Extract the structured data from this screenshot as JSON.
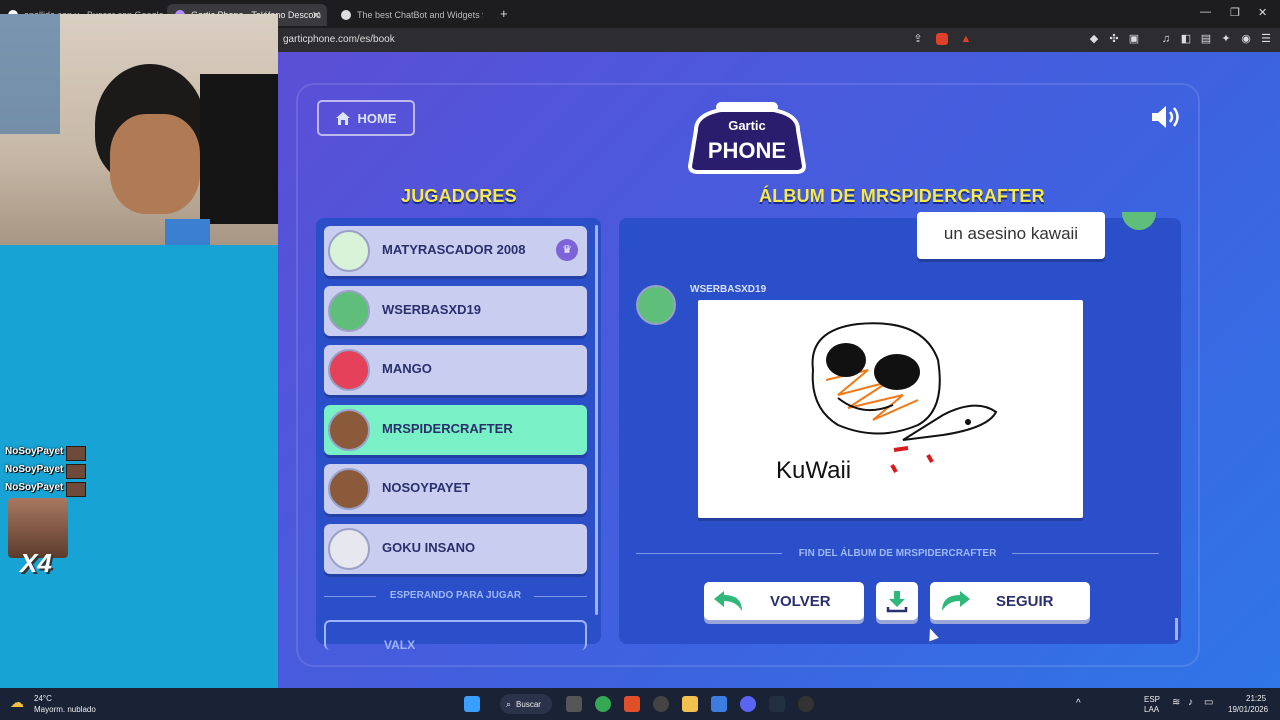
{
  "browser": {
    "tabs": [
      {
        "title": "apellido con v - Buscar con Google",
        "active": false
      },
      {
        "title": "Gartic Phone - Teléfono Descom",
        "active": true
      },
      {
        "title": "The best ChatBot and Widgets fo",
        "active": false
      }
    ],
    "new_tab_icon": "+",
    "url": "garticphone.com/es/book"
  },
  "game": {
    "home_label": "HOME",
    "logo_top": "Gartic",
    "logo_bottom": "PHONE",
    "players_heading": "JUGADORES",
    "album_heading": "ÁLBUM DE MRSPIDERCRAFTER",
    "players": [
      {
        "name": "MATYRASCADOR 2008",
        "host": true
      },
      {
        "name": "WSERBASXD19"
      },
      {
        "name": "MANGO"
      },
      {
        "name": "MRSPIDERCRAFTER",
        "highlighted": true
      },
      {
        "name": "NOSOYPAYET"
      },
      {
        "name": "GOKU INSANO"
      }
    ],
    "waiting_label": "ESPERANDO PARA JUGAR",
    "waiting_player": "VALX",
    "album": {
      "previous_text": "un asesino kawaii",
      "author": "WSERBASXD19",
      "drawing_caption": "KuWaii",
      "end_label": "FIN DEL ÁLBUM DE MRSPIDERCRAFTER",
      "back_label": "VOLVER",
      "next_label": "SEGUIR"
    }
  },
  "stream_overlay": {
    "chat": [
      "NoSoyPayet :",
      "NoSoyPayet :",
      "NoSoyPayet :"
    ],
    "multiplier": "X4"
  },
  "taskbar": {
    "weather_temp": "24°C",
    "weather_desc": "Mayorm. nublado",
    "search_label": "Buscar",
    "lang_top": "ESP",
    "lang_bottom": "LAA",
    "time": "21:25",
    "date": "19/01/2026"
  },
  "colors": {
    "accent_yellow": "#f6e94a",
    "highlight_row": "#7af0c6",
    "panel_blue": "#2b4fc8"
  }
}
